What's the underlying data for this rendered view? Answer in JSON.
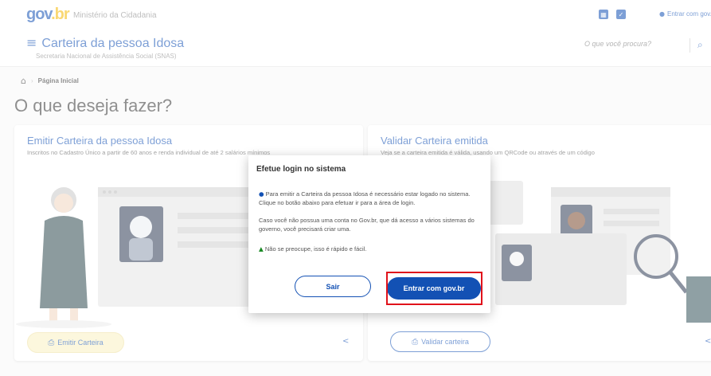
{
  "topbar": {
    "logo_part1": "gov",
    "logo_part2": ".br",
    "ministry": "Ministério da Cidadania",
    "login_text": "Entrar com gov.br"
  },
  "header": {
    "app_title": "Carteira da pessoa Idosa",
    "subtitle": "Secretaria Nacional de Assistência Social (SNAS)",
    "search_placeholder": "O que você procura?"
  },
  "breadcrumb": {
    "current": "Página Inicial"
  },
  "page_title": "O que deseja fazer?",
  "cards": {
    "emit": {
      "title": "Emitir Carteira da pessoa Idosa",
      "desc": "Inscritos no Cadastro Único a partir de 60 anos e renda individual de até 2 salários mínimos",
      "button": "Emitir Carteira"
    },
    "validate": {
      "title": "Validar Carteira emitida",
      "desc": "Veja se a carteira emitida é válida, usando um QRCode ou através de um código",
      "button": "Validar carteira"
    }
  },
  "modal": {
    "title": "Efetue login no sistema",
    "p1": "Para emitir a Carteira da pessoa Idosa é necessário estar logado no sistema. Clique no botão abaixo para efetuar ir para a área de login.",
    "p2": "Caso você não possua uma conta no Gov.br, que dá acesso a vários sistemas do governo, você precisará criar uma.",
    "p3": "Não se preocupe, isso é rápido e fácil.",
    "cancel": "Sair",
    "confirm": "Entrar com gov.br"
  },
  "colors": {
    "primary": "#1351b4",
    "highlight": "#e0121b",
    "emit_button_bg": "#faf1c2"
  },
  "icons": [
    "menu-icon",
    "search-icon",
    "home-icon",
    "user-icon",
    "info-icon",
    "thumbs-up-icon",
    "printer-icon",
    "share-icon"
  ]
}
